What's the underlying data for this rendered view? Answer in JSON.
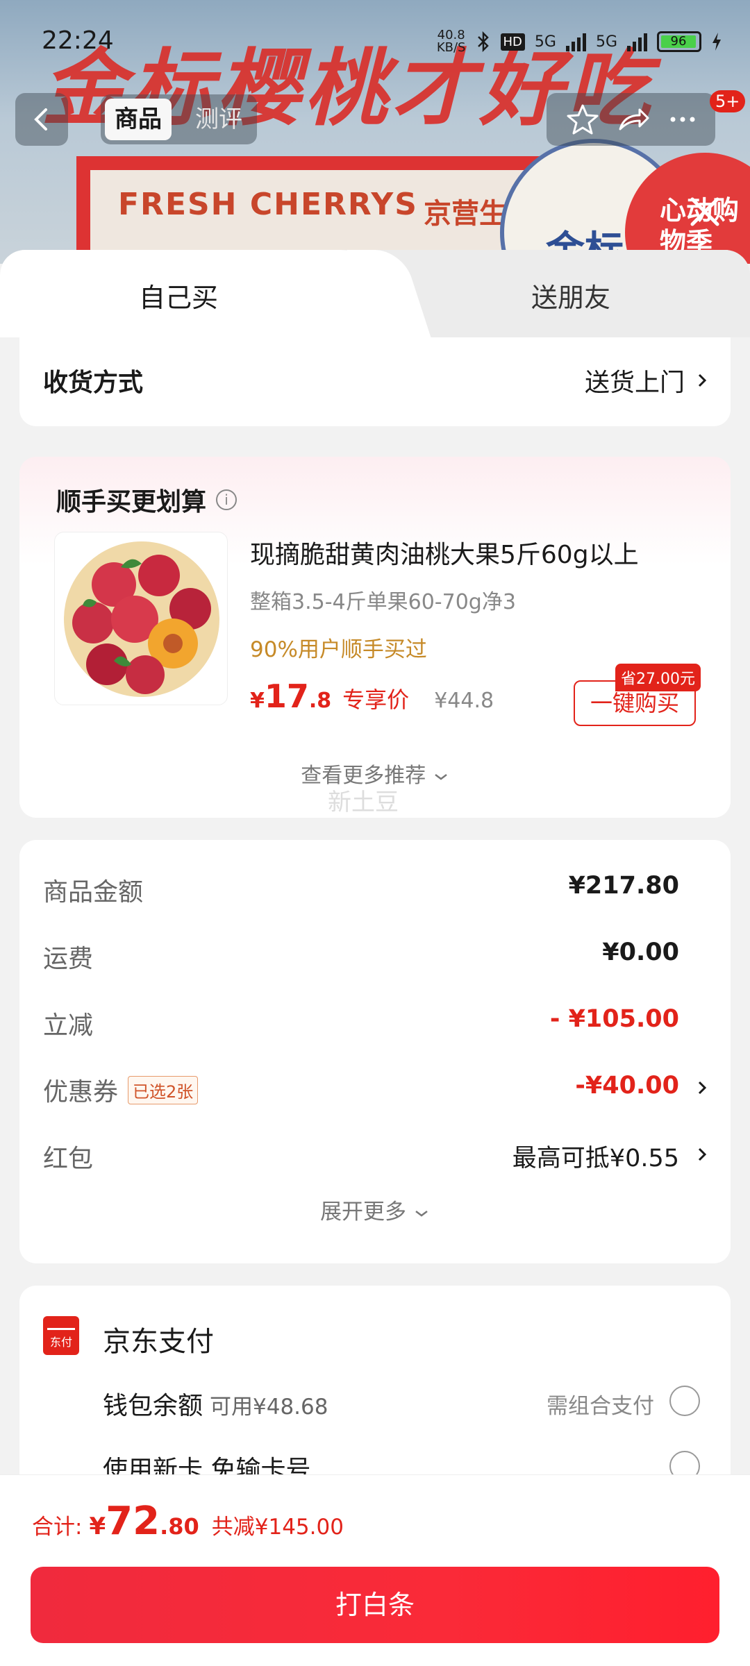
{
  "status": {
    "time": "22:24",
    "net_speed_value": "40.8",
    "net_speed_unit": "KB/S",
    "hd": "HD",
    "net1": "5G",
    "net2": "5G",
    "battery": "96"
  },
  "background": {
    "banner": "金标樱桃才好吃",
    "box_text": "FRESH CHERRYS",
    "box_sub": "京营生",
    "badge_text": "金标",
    "promo_text": "心动购物季"
  },
  "nav": {
    "tab_product": "商品",
    "tab_review": "测评",
    "badge": "5+"
  },
  "tabs": {
    "self": "自己买",
    "gift": "送朋友"
  },
  "delivery": {
    "label": "收货方式",
    "value": "送货上门"
  },
  "recommend": {
    "title": "顺手买更划算",
    "product_name": "现摘脆甜黄肉油桃大果5斤60g以上",
    "product_spec": "整箱3.5-4斤单果60-70g净3",
    "social_proof": "90%用户顺手买过",
    "price_yen": "¥",
    "price_int": "17",
    "price_dec": ".8",
    "price_tag": "专享价",
    "original_price": "¥44.8",
    "save_badge": "省27.00元",
    "buy_button": "一键购买",
    "more": "查看更多推荐",
    "ghost_text": "新土豆"
  },
  "summary": {
    "rows": [
      {
        "label": "商品金额",
        "value": "¥217.80"
      },
      {
        "label": "运费",
        "value": "¥0.00"
      },
      {
        "label": "立减",
        "value": "- ¥105.00"
      },
      {
        "label": "优惠券",
        "tag": "已选2张",
        "value": "-¥40.00"
      },
      {
        "label": "红包",
        "value": "最高可抵¥0.55"
      }
    ],
    "expand": "展开更多"
  },
  "payment": {
    "icon_text": "东付",
    "title": "京东支付",
    "wallet_label": "钱包余额",
    "wallet_sub": "可用¥48.68",
    "wallet_hint": "需组合支付",
    "newcard_label": "使用新卡 免输卡号"
  },
  "bottom": {
    "total_label": "合计:",
    "total_yen": "¥",
    "total_int": "72",
    "total_dec": ".80",
    "total_save": "共减¥145.00",
    "pay_button": "打白条"
  },
  "colors": {
    "accent": "#e2231a",
    "gold": "#c68a28",
    "background": "#f2f2f2"
  }
}
